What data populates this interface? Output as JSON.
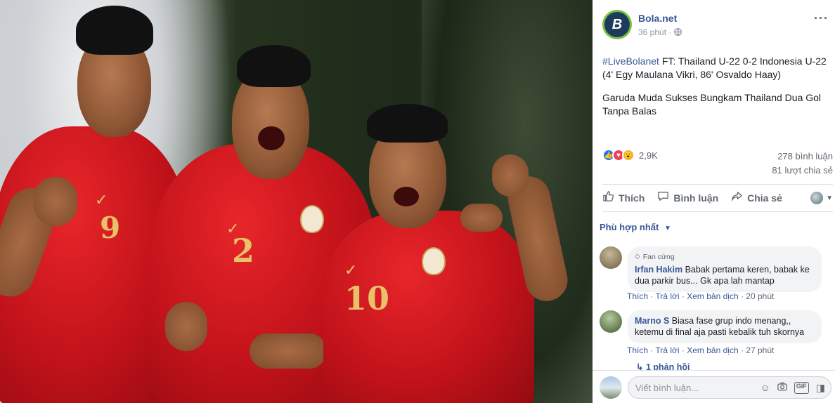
{
  "post": {
    "page_name": "Bola.net",
    "avatar_letter": "B",
    "time": "36 phút",
    "privacy_icon": "globe-icon",
    "hashtag": "#LiveBolanet",
    "text_line1": " FT: Thailand U-22 0-2 Indonesia U-22 (4' Egy Maulana Vikri, 86' Osvaldo Haay)",
    "text_line2": "Garuda Muda Sukses Bungkam Thailand Dua Gol Tanpa Balas",
    "reaction_count": "2,9K",
    "comments_count": "278 bình luận",
    "shares_count": "81 lượt chia sẻ"
  },
  "actions": {
    "like": "Thích",
    "comment": "Bình luận",
    "share": "Chia sẻ"
  },
  "sort": {
    "label": "Phù hợp nhất"
  },
  "comments": [
    {
      "badge": "Fan cứng",
      "name": "Irfan Hakim",
      "text": "Babak pertama keren, babak ke dua parkir bus... Gk apa lah mantap",
      "like": "Thích",
      "reply": "Trả lời",
      "translate": "Xem bản dịch",
      "time": "20 phút"
    },
    {
      "name": "Marno S",
      "text": "Biasa fase grup indo menang,, ketemu di final aja pasti kebalik tuh skornya",
      "like": "Thích",
      "reply": "Trả lời",
      "translate": "Xem bản dịch",
      "time": "27 phút"
    }
  ],
  "replies": {
    "label": "↳ 1 phản hồi"
  },
  "composer": {
    "placeholder": "Viết bình luận..."
  },
  "photo": {
    "jersey_numbers": [
      "9",
      "2",
      "10"
    ]
  }
}
